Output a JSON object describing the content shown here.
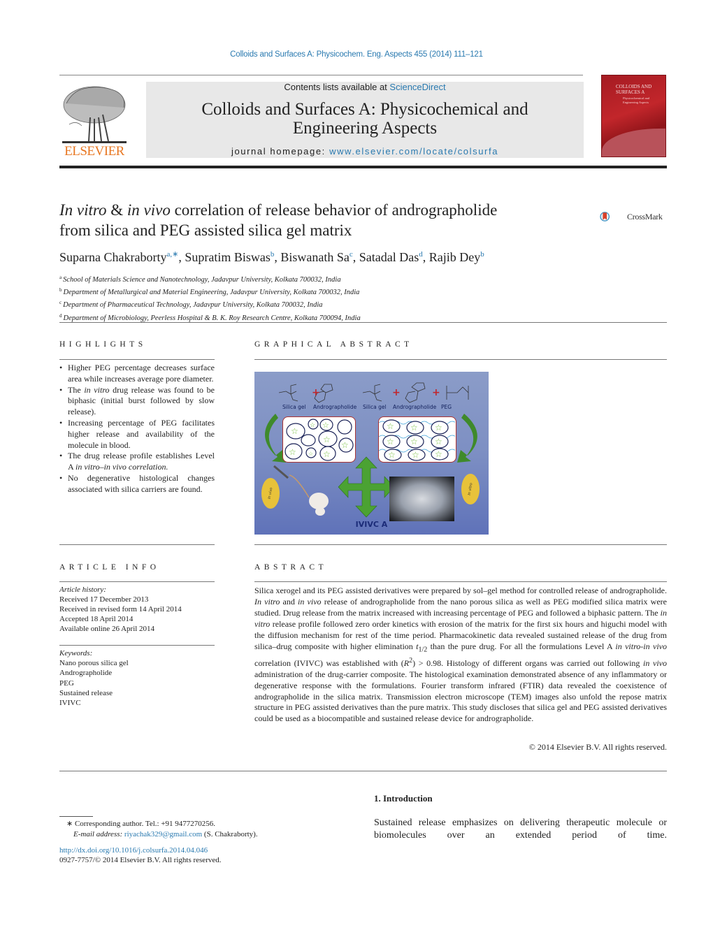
{
  "header": {
    "citation": "Colloids and Surfaces A: Physicochem. Eng. Aspects 455 (2014) 111–121",
    "contents_prefix": "Contents lists available at ",
    "contents_link": "ScienceDirect",
    "journal_title_line1": "Colloids and Surfaces A: Physicochemical and",
    "journal_title_line2": "Engineering Aspects",
    "homepage_prefix": "journal homepage: ",
    "homepage_link": "www.elsevier.com/locate/colsurfa",
    "publisher_logo": "ELSEVIER",
    "cover_title_line1": "COLLOIDS AND",
    "cover_title_line2": "SURFACES A",
    "cover_subtitle": "Physicochemical and Engineering Aspects",
    "brand_color": "#e87722",
    "link_color": "#2a7ab0"
  },
  "article": {
    "title_italic_1": "In vitro",
    "title_amp": " & ",
    "title_italic_2": "in vivo",
    "title_rest_line1": " correlation of release behavior of andrographolide",
    "title_line2": "from silica and PEG assisted silica gel matrix",
    "crossmark_label": "CrossMark",
    "authors": [
      {
        "name": "Suparna Chakraborty",
        "sup": "a,∗"
      },
      {
        "name": "Supratim Biswas",
        "sup": "b"
      },
      {
        "name": "Biswanath Sa",
        "sup": "c"
      },
      {
        "name": "Satadal Das",
        "sup": "d"
      },
      {
        "name": "Rajib Dey",
        "sup": "b"
      }
    ],
    "affiliations": [
      {
        "key": "a",
        "text": "School of Materials Science and Nanotechnology, Jadavpur University, Kolkata 700032, India"
      },
      {
        "key": "b",
        "text": "Department of Metallurgical and Material Engineering, Jadavpur University, Kolkata 700032, India"
      },
      {
        "key": "c",
        "text": "Department of Pharmaceutical Technology, Jadavpur University, Kolkata 700032, India"
      },
      {
        "key": "d",
        "text": "Department of Microbiology, Peerless Hospital & B. K. Roy Research Centre, Kolkata 700094, India"
      }
    ]
  },
  "highlights": {
    "heading": "HIGHLIGHTS",
    "items": [
      {
        "pre": "Higher PEG percentage decreases surface area while increases average pore diameter.",
        "it": "",
        "post": ""
      },
      {
        "pre": "The ",
        "it": "in vitro",
        "post": " drug release was found to be biphasic (initial burst followed by slow release)."
      },
      {
        "pre": "Increasing percentage of PEG facilitates higher release and availability of the molecule in blood.",
        "it": "",
        "post": ""
      },
      {
        "pre": "The drug release profile establishes Level A ",
        "it": "in vitro–in vivo correlation.",
        "post": ""
      },
      {
        "pre": "No degenerative histological changes associated with silica carriers are found.",
        "it": "",
        "post": ""
      }
    ]
  },
  "graphical_abstract": {
    "heading": "GRAPHICAL ABSTRACT",
    "labels": {
      "silica_gel_1": "Silica gel",
      "andrographolide_1": "Andrographolide",
      "silica_gel_2": "Silica gel",
      "andrographolide_2": "Andrographolide",
      "peg": "PEG",
      "in_vivo": "In vivo",
      "in_vitro": "In vitro",
      "ivivc": "IVIVC A"
    }
  },
  "article_info": {
    "heading": "ARTICLE INFO",
    "history_label": "Article history:",
    "history": [
      "Received 17 December 2013",
      "Received in revised form 14 April 2014",
      "Accepted 18 April 2014",
      "Available online 26 April 2014"
    ],
    "keywords_label": "Keywords:",
    "keywords": [
      "Nano porous silica gel",
      "Andrographolide",
      "PEG",
      "Sustained release",
      "IVIVC"
    ]
  },
  "abstract": {
    "heading": "ABSTRACT",
    "p1": "Silica xerogel and its PEG assisted derivatives were prepared by sol–gel method for controlled release of andrographolide. ",
    "it1": "In vitro",
    "p2": " and ",
    "it2": "in vivo",
    "p3": " release of andrographolide from the nano porous silica as well as PEG modified silica matrix were studied. Drug release from the matrix increased with increasing percentage of PEG and followed a biphasic pattern. The ",
    "it3": "in vitro",
    "p4": " release profile followed zero order kinetics with erosion of the matrix for the first six hours and higuchi model with the diffusion mechanism for rest of the time period. Pharmacokinetic data revealed sustained release of the drug from silica–drug composite with higher elimination ",
    "it4": "t",
    "sub4": "1/2",
    "p5": " than the pure drug. For all the formulations Level A ",
    "it5": "in vitro-in vivo",
    "p6": " correlation (IVIVC) was established with (",
    "it6": "R",
    "sup6": "2",
    "p7": ") > 0.98. Histology of different organs was carried out following ",
    "it7": "in vivo",
    "p8": " administration of the drug-carrier composite. The histological examination demonstrated absence of any inflammatory or degenerative response with the formulations. Fourier transform infrared (FTIR) data revealed the coexistence of andrographolide in the silica matrix. Transmission electron microscope (TEM) images also unfold the repose matrix structure in PEG assisted derivatives than the pure matrix. This study discloses that silica gel and PEG assisted derivatives could be used as a biocompatible and sustained release device for andrographolide.",
    "copyright": "© 2014 Elsevier B.V. All rights reserved."
  },
  "introduction": {
    "heading": "1.  Introduction",
    "text": "Sustained release emphasizes on delivering therapeutic molecule or biomolecules over an extended period of time."
  },
  "footnotes": {
    "corresponding": "∗  Corresponding author. Tel.: +91 9477270256.",
    "email_label": "E-mail address:",
    "email": "riyachak329@gmail.com",
    "email_suffix": " (S. Chakraborty).",
    "doi": "http://dx.doi.org/10.1016/j.colsurfa.2014.04.046",
    "issn": "0927-7757/© 2014 Elsevier B.V. All rights reserved."
  }
}
